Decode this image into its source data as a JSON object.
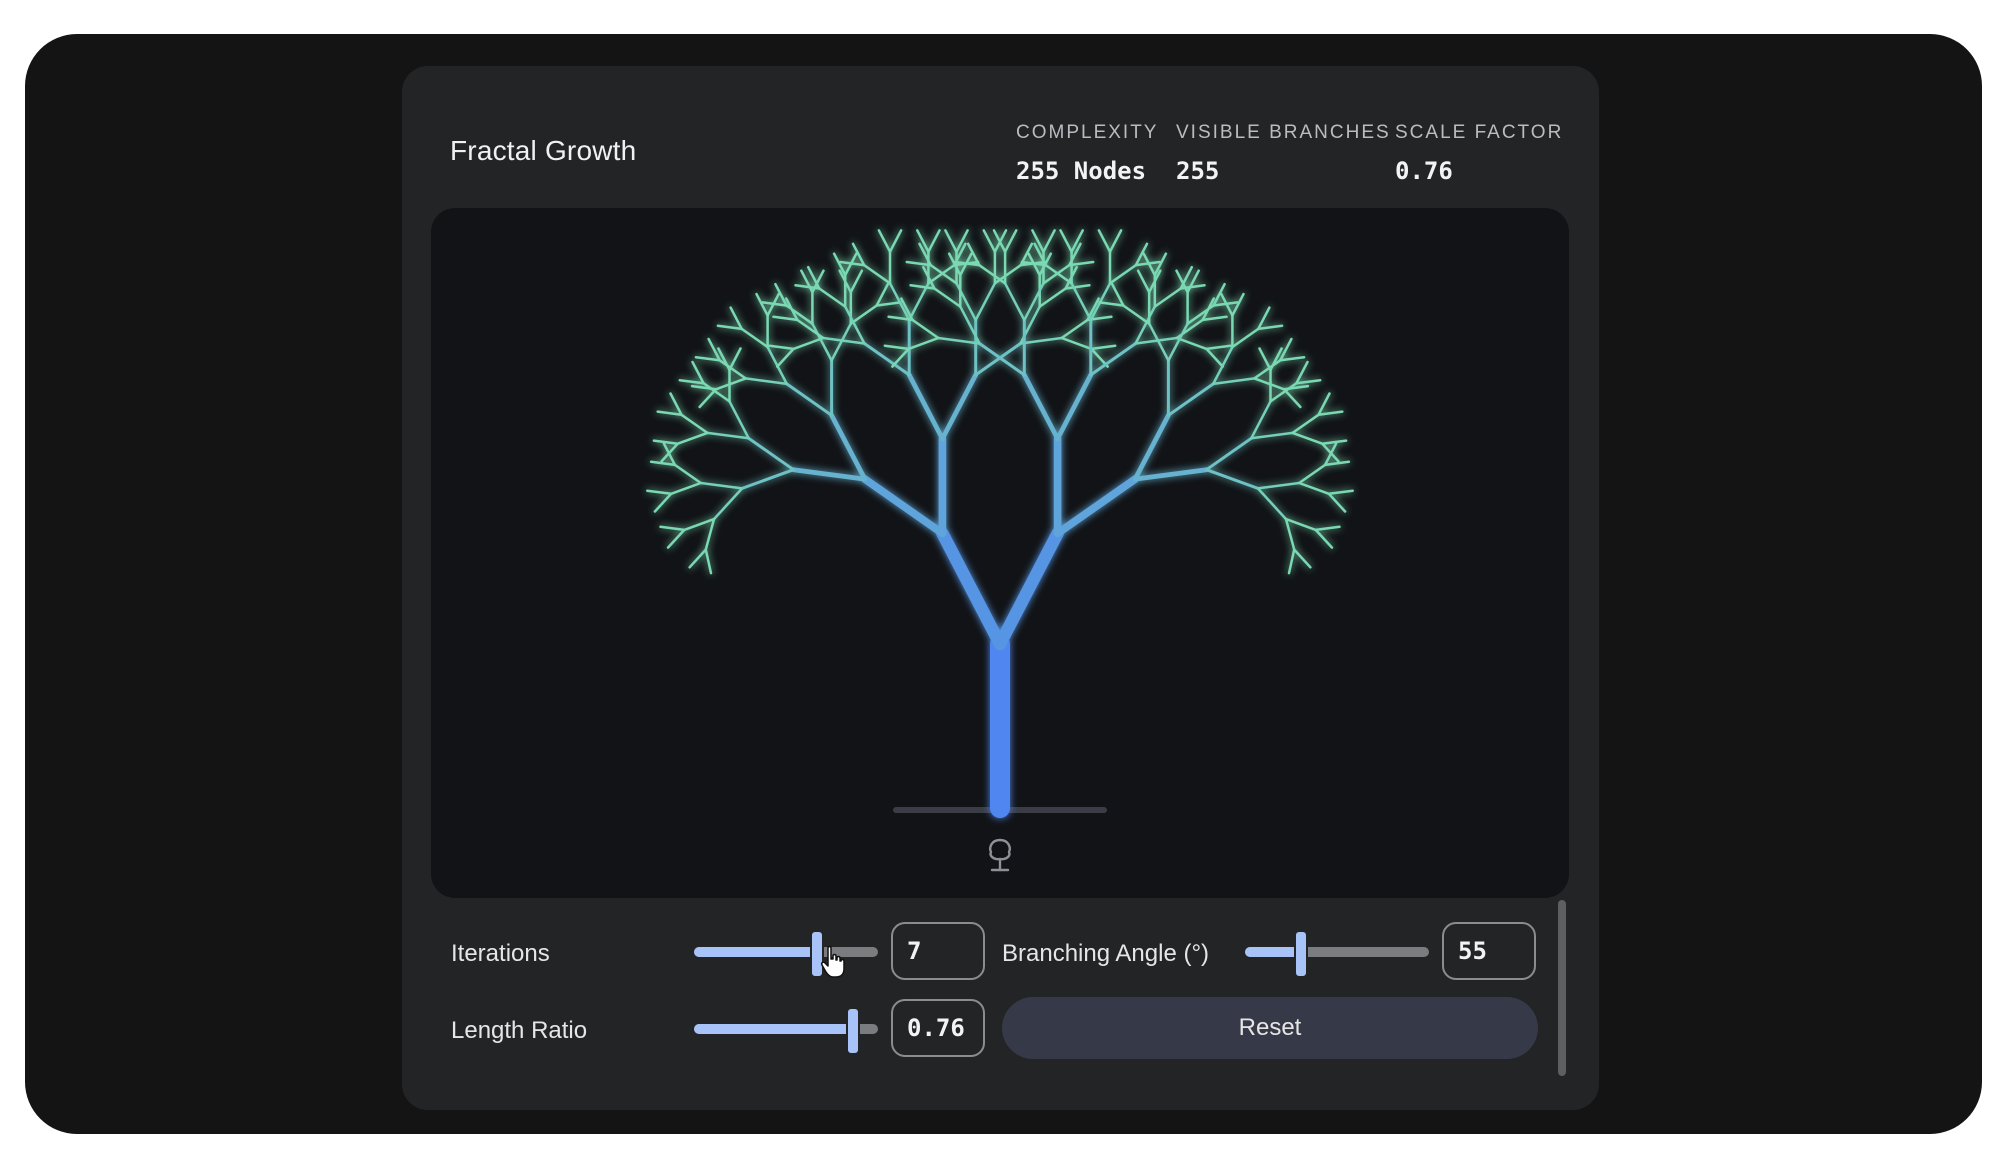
{
  "app": {
    "title": "Fractal Growth"
  },
  "stats": [
    {
      "label": "COMPLEXITY",
      "value": "255 Nodes"
    },
    {
      "label": "VISIBLE BRANCHES",
      "value": "255"
    },
    {
      "label": "SCALE FACTOR",
      "value": "0.76"
    }
  ],
  "controls": {
    "iterations": {
      "label": "Iterations",
      "value": "7",
      "min": 1,
      "max": 10,
      "current": 7
    },
    "branching_angle": {
      "label": "Branching Angle (°)",
      "value": "55",
      "min": 0,
      "max": 180,
      "current": 55
    },
    "length_ratio": {
      "label": "Length Ratio",
      "value": "0.76",
      "min": 0.5,
      "max": 0.8,
      "current": 0.76
    },
    "reset_label": "Reset"
  },
  "canvas": {
    "icons": [
      "tree-icon"
    ]
  },
  "colors": {
    "trunk": "#4f86ef",
    "leaf": "#7ad9b3",
    "accent": "#a8c3f7",
    "background": "#111316"
  }
}
